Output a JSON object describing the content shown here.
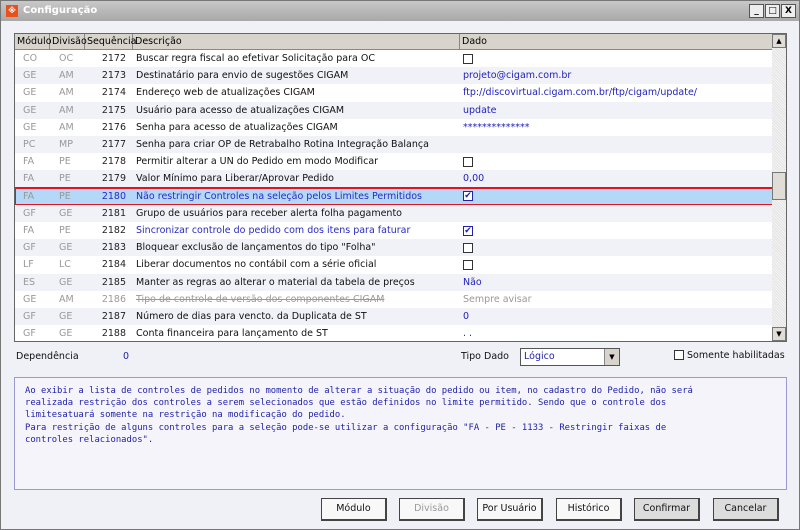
{
  "window": {
    "title": "Configuração",
    "minimize": "_",
    "maximize": "□",
    "close": "X"
  },
  "grid": {
    "columns": [
      "Módulo",
      "Divisão",
      "Sequência",
      "Descrição",
      "Dado"
    ],
    "rows": [
      {
        "modulo": "CO",
        "divisao": "OC",
        "seq": "2172",
        "desc": "Buscar regra fiscal ao efetivar Solicitação para OC",
        "dado": "",
        "checkbox": "unchecked"
      },
      {
        "modulo": "GE",
        "divisao": "AM",
        "seq": "2173",
        "desc": "Destinatário para envio de sugestões CIGAM",
        "dado": "projeto@cigam.com.br"
      },
      {
        "modulo": "GE",
        "divisao": "AM",
        "seq": "2174",
        "desc": "Endereço web de atualizações CIGAM",
        "dado": "ftp://discovirtual.cigam.com.br/ftp/cigam/update/"
      },
      {
        "modulo": "GE",
        "divisao": "AM",
        "seq": "2175",
        "desc": "Usuário para acesso de atualizações CIGAM",
        "dado": "update"
      },
      {
        "modulo": "GE",
        "divisao": "AM",
        "seq": "2176",
        "desc": "Senha para acesso de atualizações CIGAM",
        "dado": "**************"
      },
      {
        "modulo": "PC",
        "divisao": "MP",
        "seq": "2177",
        "desc": "Senha para criar OP de Retrabalho Rotina Integração Balança",
        "dado": ""
      },
      {
        "modulo": "FA",
        "divisao": "PE",
        "seq": "2178",
        "desc": "Permitir alterar a UN do Pedido em modo Modificar",
        "dado": "",
        "checkbox": "unchecked"
      },
      {
        "modulo": "FA",
        "divisao": "PE",
        "seq": "2179",
        "desc": "Valor Mínimo para Liberar/Aprovar Pedido",
        "dado": "0,00"
      },
      {
        "modulo": "FA",
        "divisao": "PE",
        "seq": "2180",
        "desc": "Não restringir Controles na seleção pelos Limites Permitidos",
        "dado": "",
        "checkbox": "checked",
        "selected": true
      },
      {
        "modulo": "GF",
        "divisao": "GE",
        "seq": "2181",
        "desc": "Grupo de usuários para receber alerta folha pagamento",
        "dado": ""
      },
      {
        "modulo": "FA",
        "divisao": "PE",
        "seq": "2182",
        "desc": "Sincronizar controle do pedido com dos itens para faturar",
        "dado": "",
        "checkbox": "checked",
        "style": "blue"
      },
      {
        "modulo": "GF",
        "divisao": "GE",
        "seq": "2183",
        "desc": "Bloquear exclusão de lançamentos do tipo \"Folha\"",
        "dado": "",
        "checkbox": "unchecked"
      },
      {
        "modulo": "LF",
        "divisao": "LC",
        "seq": "2184",
        "desc": "Liberar documentos no contábil com a série oficial",
        "dado": "",
        "checkbox": "unchecked"
      },
      {
        "modulo": "ES",
        "divisao": "GE",
        "seq": "2185",
        "desc": "Manter as regras ao alterar o material da tabela de preços",
        "dado": "Não"
      },
      {
        "modulo": "GE",
        "divisao": "AM",
        "seq": "2186",
        "desc": "Tipo de controle de versão dos componentes CIGAM",
        "dado": "Sempre avisar",
        "style": "strike"
      },
      {
        "modulo": "GF",
        "divisao": "GE",
        "seq": "2187",
        "desc": "Número de dias para vencto. da Duplicata de ST",
        "dado": "0"
      },
      {
        "modulo": "GF",
        "divisao": "GE",
        "seq": "2188",
        "desc": "Conta financeira para lançamento de ST",
        "dado": ". ."
      }
    ]
  },
  "filters": {
    "dependencia_label": "Dependência",
    "dependencia_value": "0",
    "tipo_dado_label": "Tipo Dado",
    "tipo_dado_value": "Lógico",
    "somente_label": "Somente habilitadas"
  },
  "description": "Ao exibir a lista de controles de pedidos no momento de alterar a situação do pedido ou item, no cadastro do Pedido, não será\nrealizada restrição dos controles a serem selecionados que estão definidos no limite permitido. Sendo que o controle dos\nlimitesatuará somente na restrição na modificação do pedido.\nPara restrição de alguns controles para a seleção pode-se utilizar a configuração \"FA - PE - 1133 - Restringir faixas de\ncontroles relacionados\".",
  "buttons": {
    "modulo": "Módulo",
    "divisao": "Divisão",
    "por_usuario": "Por Usuário",
    "historico": "Histórico",
    "confirmar": "Confirmar",
    "cancelar": "Cancelar"
  }
}
